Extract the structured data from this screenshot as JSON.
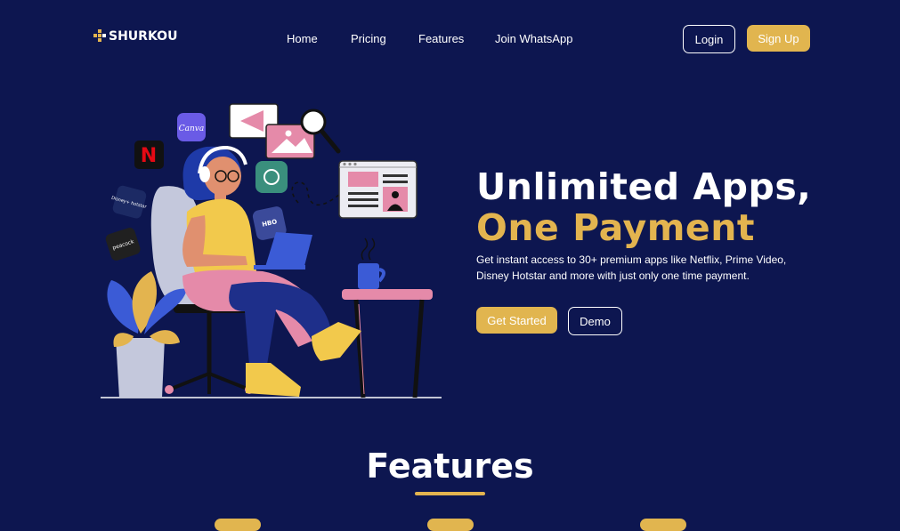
{
  "brand": {
    "name": "SHURKOU"
  },
  "nav": {
    "items": [
      {
        "label": "Home"
      },
      {
        "label": "Pricing"
      },
      {
        "label": "Features"
      },
      {
        "label": "Join WhatsApp"
      }
    ],
    "login_label": "Login",
    "signup_label": "Sign Up"
  },
  "hero": {
    "title_line1": "Unlimited Apps,",
    "title_line2": "One Payment",
    "description": "Get instant access to 30+ premium apps like Netflix, Prime Video, Disney Hotstar and more with just only one time payment.",
    "get_started_label": "Get Started",
    "demo_label": "Demo",
    "illustration_icons": {
      "canva": "Canva",
      "netflix": "N",
      "hbo": "HBO",
      "disney": "Disney+ hotstar",
      "peacock": "peacock"
    }
  },
  "features": {
    "title": "Features"
  },
  "colors": {
    "background": "#0d1650",
    "accent": "#e3b44f",
    "text": "#ffffff"
  }
}
